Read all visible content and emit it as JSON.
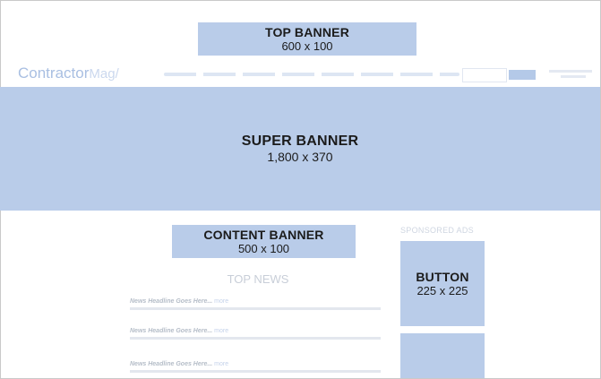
{
  "top_banner": {
    "title": "TOP BANNER",
    "size": "600 x 100"
  },
  "navbar": {
    "logo_main": "Contractor",
    "logo_accent": "Mag",
    "logo_tail": "/"
  },
  "super_banner": {
    "title": "SUPER BANNER",
    "size": "1,800 x 370"
  },
  "content_banner": {
    "title": "CONTENT BANNER",
    "size": "500 x 100"
  },
  "sidebar": {
    "sponsored_label": "SPONSORED ADS"
  },
  "button_ad": {
    "title": "BUTTON",
    "size": "225 x 225"
  },
  "top_news": {
    "heading": "TOP NEWS",
    "items": [
      {
        "headline": "News Headline Goes Here...",
        "more": "more"
      },
      {
        "headline": "News Headline Goes Here...",
        "more": "more"
      },
      {
        "headline": "News Headline Goes Here...",
        "more": "more"
      }
    ]
  },
  "colors": {
    "ad_placeholder": "#b9cce9",
    "logo": "#9eb7de"
  }
}
